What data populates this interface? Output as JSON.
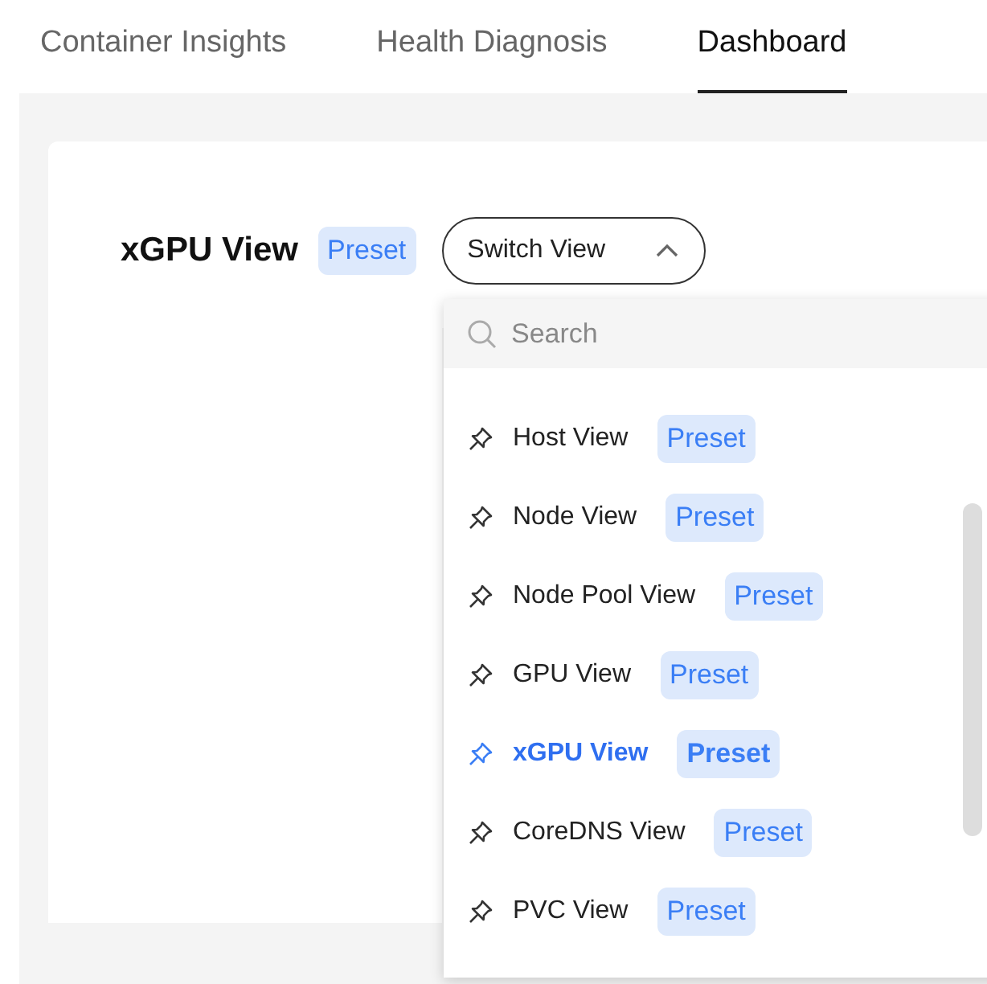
{
  "tabs": [
    {
      "label": "Container Insights",
      "selected": false
    },
    {
      "label": "Health Diagnosis",
      "selected": false
    },
    {
      "label": "Dashboard",
      "selected": true
    }
  ],
  "view": {
    "title": "xGPU View",
    "badge": "Preset"
  },
  "switch": {
    "label": "Switch View",
    "expanded": true
  },
  "dropdown": {
    "search": {
      "placeholder": "Search"
    },
    "items": [
      {
        "name": "Host View",
        "badge": "Preset",
        "selected": false
      },
      {
        "name": "Node View",
        "badge": "Preset",
        "selected": false
      },
      {
        "name": "Node Pool View",
        "badge": "Preset",
        "selected": false
      },
      {
        "name": "GPU View",
        "badge": "Preset",
        "selected": false
      },
      {
        "name": "xGPU View",
        "badge": "Preset",
        "selected": true
      },
      {
        "name": "CoreDNS View",
        "badge": "Preset",
        "selected": false
      },
      {
        "name": "PVC View",
        "badge": "Preset",
        "selected": false
      }
    ]
  }
}
